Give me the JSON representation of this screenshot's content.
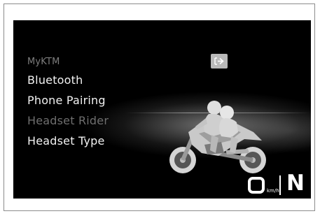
{
  "menu": {
    "title": "MyKTM",
    "items": [
      {
        "label": "Bluetooth",
        "state": "normal"
      },
      {
        "label": "Phone Pairing",
        "state": "normal"
      },
      {
        "label": "Headset Rider",
        "state": "dimmed"
      },
      {
        "label": "Headset Type",
        "state": "normal"
      }
    ]
  },
  "back_button": {
    "icon": "back-arrow-icon"
  },
  "status": {
    "speed": "0",
    "speed_unit": "km/h",
    "gear": "N"
  },
  "colors": {
    "screen_bg": "#000000",
    "text": "#f2f2f2",
    "dimmed_text": "#6f6f6f",
    "button_bg": "#b9b9b9"
  },
  "illustration": {
    "subject": "motorcycle-with-rider-and-passenger"
  }
}
